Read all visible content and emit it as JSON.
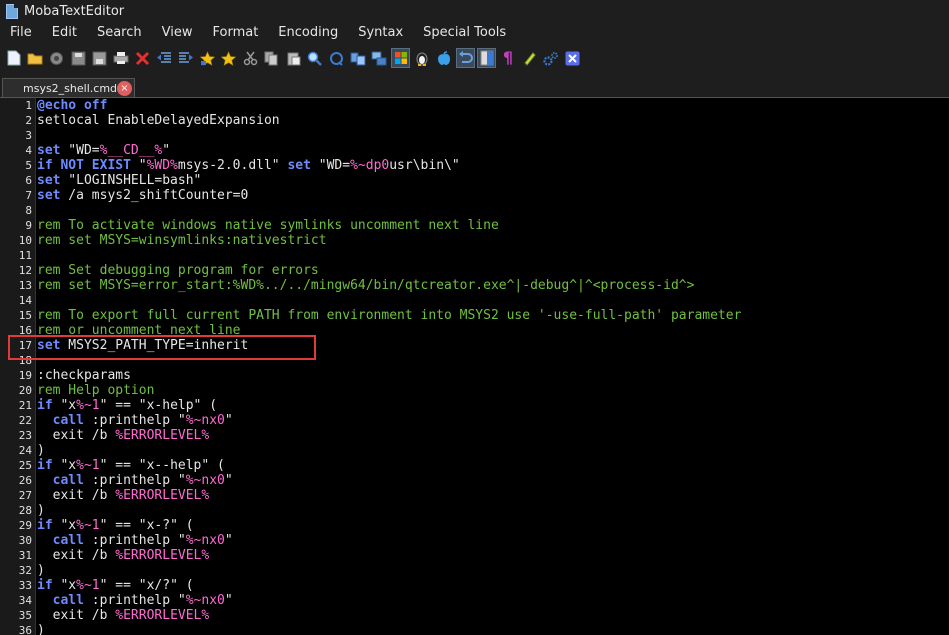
{
  "window": {
    "title": "MobaTextEditor"
  },
  "menu": [
    "File",
    "Edit",
    "Search",
    "View",
    "Format",
    "Encoding",
    "Syntax",
    "Special Tools"
  ],
  "toolbar": {
    "icons": [
      "new-file-icon",
      "open-folder-icon",
      "reload-icon",
      "save-icon",
      "save-all-icon",
      "print-icon",
      "close-file-icon",
      "outdent-icon",
      "indent-icon",
      "bookmark-icon",
      "bookmark-next-icon",
      "cut-icon",
      "copy-icon",
      "paste-icon",
      "search-icon",
      "replace-icon",
      "compare-icon",
      "compare-files-icon",
      "windows-eol-icon",
      "linux-eol-icon",
      "mac-eol-icon",
      "undo-icon",
      "split-view-icon",
      "pilcrow-icon",
      "highlighter-icon",
      "settings-icon",
      "exit-icon"
    ]
  },
  "tab": {
    "label": "msys2_shell.cmd",
    "close": "×"
  },
  "editor": {
    "lines": [
      {
        "n": "1",
        "parts": [
          [
            "kw",
            "@echo off"
          ]
        ]
      },
      {
        "n": "2",
        "parts": [
          [
            "t",
            "setlocal EnableDelayedExpansion"
          ]
        ]
      },
      {
        "n": "3",
        "parts": []
      },
      {
        "n": "4",
        "parts": [
          [
            "kw",
            "set"
          ],
          [
            "t",
            " \"WD="
          ],
          [
            "var",
            "%__CD__%"
          ],
          [
            "t",
            "\""
          ]
        ]
      },
      {
        "n": "5",
        "parts": [
          [
            "kw",
            "if NOT EXIST"
          ],
          [
            "t",
            " \""
          ],
          [
            "var",
            "%WD%"
          ],
          [
            "t",
            "msys-2.0.dll\" "
          ],
          [
            "kw",
            "set"
          ],
          [
            "t",
            " \"WD="
          ],
          [
            "var",
            "%~dp0"
          ],
          [
            "t",
            "usr\\bin\\\""
          ]
        ]
      },
      {
        "n": "6",
        "parts": [
          [
            "kw",
            "set"
          ],
          [
            "t",
            " \"LOGINSHELL=bash\""
          ]
        ]
      },
      {
        "n": "7",
        "parts": [
          [
            "kw",
            "set"
          ],
          [
            "t",
            " /a msys2_shiftCounter=0"
          ]
        ]
      },
      {
        "n": "8",
        "parts": []
      },
      {
        "n": "9",
        "parts": [
          [
            "cm",
            "rem To activate windows native symlinks uncomment next line"
          ]
        ]
      },
      {
        "n": "10",
        "parts": [
          [
            "cm",
            "rem set MSYS=winsymlinks:nativestrict"
          ]
        ]
      },
      {
        "n": "11",
        "parts": []
      },
      {
        "n": "12",
        "parts": [
          [
            "cm",
            "rem Set debugging program for errors"
          ]
        ]
      },
      {
        "n": "13",
        "parts": [
          [
            "cm",
            "rem set MSYS=error_start:%WD%../../mingw64/bin/qtcreator.exe^|-debug^|^<process-id^>"
          ]
        ]
      },
      {
        "n": "14",
        "parts": []
      },
      {
        "n": "15",
        "parts": [
          [
            "cm",
            "rem To export full current PATH from environment into MSYS2 use '-use-full-path' parameter"
          ]
        ]
      },
      {
        "n": "16",
        "parts": [
          [
            "cm",
            "rem or uncomment next line"
          ]
        ]
      },
      {
        "n": "17",
        "parts": [
          [
            "kw",
            "set"
          ],
          [
            "t",
            " MSYS2_PATH_TYPE=inherit"
          ]
        ]
      },
      {
        "n": "18",
        "parts": []
      },
      {
        "n": "19",
        "parts": [
          [
            "t",
            ":checkparams"
          ]
        ]
      },
      {
        "n": "20",
        "parts": [
          [
            "cm",
            "rem Help option"
          ]
        ]
      },
      {
        "n": "21",
        "parts": [
          [
            "kw",
            "if"
          ],
          [
            "t",
            " \"x"
          ],
          [
            "var",
            "%~1"
          ],
          [
            "t",
            "\" == \"x-help\" ("
          ]
        ]
      },
      {
        "n": "22",
        "parts": [
          [
            "t",
            "  "
          ],
          [
            "kw",
            "call"
          ],
          [
            "t",
            " :printhelp \""
          ],
          [
            "var",
            "%~nx0"
          ],
          [
            "t",
            "\""
          ]
        ]
      },
      {
        "n": "23",
        "parts": [
          [
            "t",
            "  exit /b "
          ],
          [
            "var",
            "%ERRORLEVEL%"
          ]
        ]
      },
      {
        "n": "24",
        "parts": [
          [
            "t",
            ")"
          ]
        ]
      },
      {
        "n": "25",
        "parts": [
          [
            "kw",
            "if"
          ],
          [
            "t",
            " \"x"
          ],
          [
            "var",
            "%~1"
          ],
          [
            "t",
            "\" == \"x--help\" ("
          ]
        ]
      },
      {
        "n": "26",
        "parts": [
          [
            "t",
            "  "
          ],
          [
            "kw",
            "call"
          ],
          [
            "t",
            " :printhelp \""
          ],
          [
            "var",
            "%~nx0"
          ],
          [
            "t",
            "\""
          ]
        ]
      },
      {
        "n": "27",
        "parts": [
          [
            "t",
            "  exit /b "
          ],
          [
            "var",
            "%ERRORLEVEL%"
          ]
        ]
      },
      {
        "n": "28",
        "parts": [
          [
            "t",
            ")"
          ]
        ]
      },
      {
        "n": "29",
        "parts": [
          [
            "kw",
            "if"
          ],
          [
            "t",
            " \"x"
          ],
          [
            "var",
            "%~1"
          ],
          [
            "t",
            "\" == \"x-?\" ("
          ]
        ]
      },
      {
        "n": "30",
        "parts": [
          [
            "t",
            "  "
          ],
          [
            "kw",
            "call"
          ],
          [
            "t",
            " :printhelp \""
          ],
          [
            "var",
            "%~nx0"
          ],
          [
            "t",
            "\""
          ]
        ]
      },
      {
        "n": "31",
        "parts": [
          [
            "t",
            "  exit /b "
          ],
          [
            "var",
            "%ERRORLEVEL%"
          ]
        ]
      },
      {
        "n": "32",
        "parts": [
          [
            "t",
            ")"
          ]
        ]
      },
      {
        "n": "33",
        "parts": [
          [
            "kw",
            "if"
          ],
          [
            "t",
            " \"x"
          ],
          [
            "var",
            "%~1"
          ],
          [
            "t",
            "\" == \"x/?\" ("
          ]
        ]
      },
      {
        "n": "34",
        "parts": [
          [
            "t",
            "  "
          ],
          [
            "kw",
            "call"
          ],
          [
            "t",
            " :printhelp \""
          ],
          [
            "var",
            "%~nx0"
          ],
          [
            "t",
            "\""
          ]
        ]
      },
      {
        "n": "35",
        "parts": [
          [
            "t",
            "  exit /b "
          ],
          [
            "var",
            "%ERRORLEVEL%"
          ]
        ]
      },
      {
        "n": "36",
        "parts": [
          [
            "t",
            ")"
          ]
        ]
      }
    ]
  },
  "colors": {
    "keyword": "#6d8bff",
    "comment": "#70c040",
    "variable": "#ff6bd1",
    "highlight_box": "#e03a3a"
  }
}
